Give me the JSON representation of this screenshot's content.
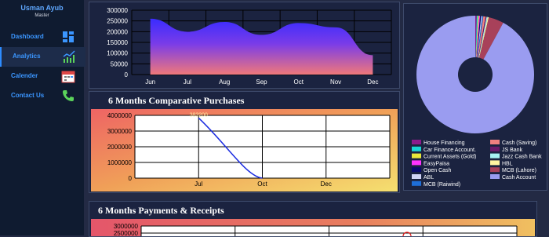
{
  "user": {
    "name": "Usman Ayub",
    "role": "Master"
  },
  "nav": [
    {
      "label": "Dashboard",
      "icon": "dashboard-icon"
    },
    {
      "label": "Analytics",
      "icon": "analytics-icon"
    },
    {
      "label": "Calender",
      "icon": "calendar-icon"
    },
    {
      "label": "Contact Us",
      "icon": "phone-icon"
    }
  ],
  "colors": {
    "accent": "#3b96ff",
    "sidebar": "#0f1b30",
    "background": "#232a44"
  },
  "panels": {
    "purchases_title": "6 Months Comparative Purchases",
    "payments_title": "6 Months Payments & Receipts"
  },
  "chart_data": [
    {
      "type": "area",
      "x": [
        "Jun",
        "Jul",
        "Aug",
        "Sep",
        "Oct",
        "Nov",
        "Dec"
      ],
      "values": [
        260000,
        200000,
        245000,
        185000,
        240000,
        220000,
        90000
      ],
      "ylim": [
        0,
        300000
      ],
      "yticks": [
        "300000",
        "250000",
        "200000",
        "150000",
        "100000",
        "50000",
        "0"
      ]
    },
    {
      "type": "line",
      "x": [
        "Jul",
        "Oct",
        "Dec"
      ],
      "values": [
        3832000,
        0,
        null
      ],
      "data_labels": [
        "383200"
      ],
      "ylim": [
        0,
        4000000
      ],
      "yticks": [
        "4000000",
        "3000000",
        "2000000",
        "1000000",
        "0"
      ]
    },
    {
      "type": "pie",
      "slices": [
        {
          "label": "House Financing",
          "value": 0.4,
          "color": "#8b1a8b"
        },
        {
          "label": "Car Finance Account.",
          "value": 0.3,
          "color": "#19d5d5"
        },
        {
          "label": "Current Assets (Gold)",
          "value": 0.3,
          "color": "#e8e83a"
        },
        {
          "label": "EasyPaisa",
          "value": 0.3,
          "color": "#ff33ff"
        },
        {
          "label": "Open Cash",
          "value": 0.3,
          "color": "#0a0a6b"
        },
        {
          "label": "ABL",
          "value": 0.3,
          "color": "#cfd3f5"
        },
        {
          "label": "MCB (Raiwind)",
          "value": 0.3,
          "color": "#1e6ed8"
        },
        {
          "label": "Cash (Saving)",
          "value": 0.6,
          "color": "#f08080"
        },
        {
          "label": "JS Bank",
          "value": 0.3,
          "color": "#6a1a6a"
        },
        {
          "label": "Jazz Cash Bank",
          "value": 0.3,
          "color": "#a6f2f2"
        },
        {
          "label": "HBL",
          "value": 0.3,
          "color": "#fff5a0"
        },
        {
          "label": "MCB (Lahore)",
          "value": 4.2,
          "color": "#a8415a"
        },
        {
          "label": "Cash  Account",
          "value": 92.3,
          "color": "#9a9cf0"
        }
      ]
    },
    {
      "type": "line",
      "x": [],
      "values": [],
      "yticks": [
        "3000000",
        "2500000"
      ]
    }
  ]
}
